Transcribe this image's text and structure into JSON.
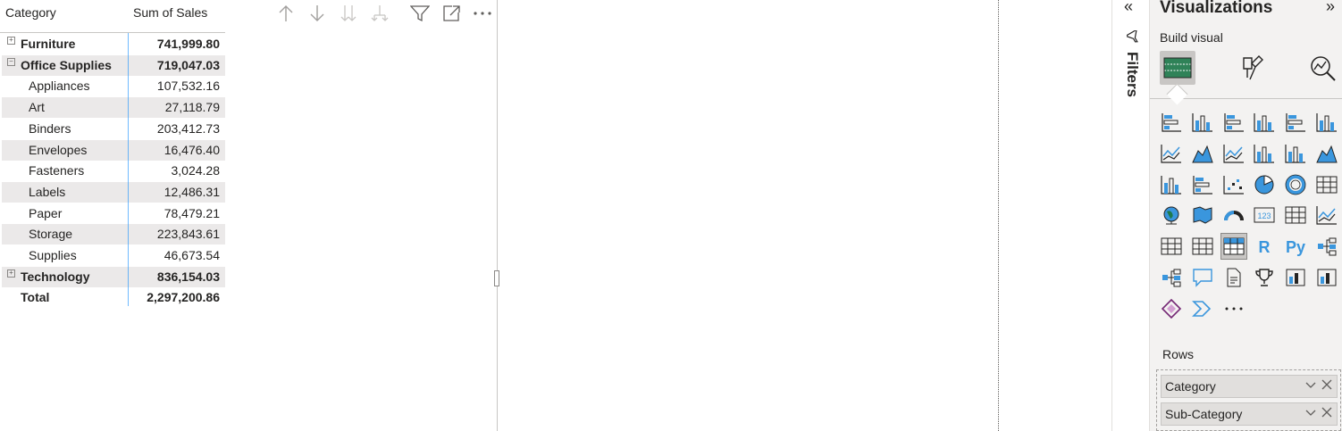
{
  "matrix": {
    "headers": {
      "category": "Category",
      "sales": "Sum of Sales"
    },
    "rows": [
      {
        "label": "Furniture",
        "value": "741,999.80",
        "level": 0,
        "bold": true,
        "expander": "+",
        "shade": false
      },
      {
        "label": "Office Supplies",
        "value": "719,047.03",
        "level": 0,
        "bold": true,
        "expander": "−",
        "shade": true
      },
      {
        "label": "Appliances",
        "value": "107,532.16",
        "level": 1,
        "bold": false,
        "shade": false
      },
      {
        "label": "Art",
        "value": "27,118.79",
        "level": 1,
        "bold": false,
        "shade": true
      },
      {
        "label": "Binders",
        "value": "203,412.73",
        "level": 1,
        "bold": false,
        "shade": false
      },
      {
        "label": "Envelopes",
        "value": "16,476.40",
        "level": 1,
        "bold": false,
        "shade": true
      },
      {
        "label": "Fasteners",
        "value": "3,024.28",
        "level": 1,
        "bold": false,
        "shade": false
      },
      {
        "label": "Labels",
        "value": "12,486.31",
        "level": 1,
        "bold": false,
        "shade": true
      },
      {
        "label": "Paper",
        "value": "78,479.21",
        "level": 1,
        "bold": false,
        "shade": false
      },
      {
        "label": "Storage",
        "value": "223,843.61",
        "level": 1,
        "bold": false,
        "shade": true
      },
      {
        "label": "Supplies",
        "value": "46,673.54",
        "level": 1,
        "bold": false,
        "shade": false
      },
      {
        "label": "Technology",
        "value": "836,154.03",
        "level": 0,
        "bold": true,
        "expander": "+",
        "shade": true
      },
      {
        "label": "Total",
        "value": "2,297,200.86",
        "level": 0,
        "bold": true,
        "shade": false
      }
    ],
    "toolbar": [
      "drill-up-icon",
      "drill-down-icon",
      "next-level-icon",
      "expand-all-icon",
      "filter-icon",
      "focus-mode-icon",
      "more-options-icon"
    ]
  },
  "filters_pane": {
    "label": "Filters"
  },
  "viz_pane": {
    "title": "Visualizations",
    "build_label": "Build visual",
    "more_label": "···",
    "rows_label": "Rows",
    "fields": [
      "Category",
      "Sub-Category"
    ]
  },
  "colors": {
    "accent": "#118dff",
    "shade": "#ebe9e9",
    "pane": "#f3f2f1",
    "icon_blue": "#3a96dd",
    "icon_dark": "#252423"
  }
}
